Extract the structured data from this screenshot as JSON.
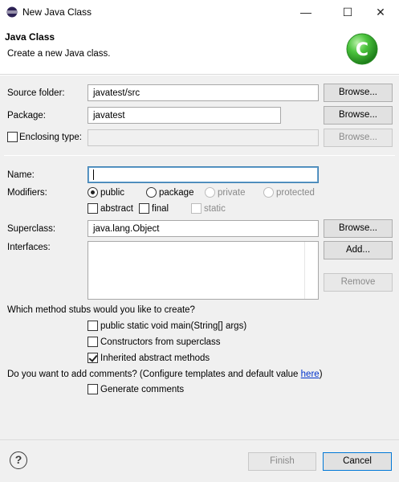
{
  "window": {
    "title": "New Java Class",
    "minimize": "—",
    "maximize": "☐",
    "close": "✕"
  },
  "header": {
    "title": "Java Class",
    "message": "Create a new Java class."
  },
  "form": {
    "source_folder": {
      "label": "Source folder:",
      "value": "javatest/src",
      "browse": "Browse..."
    },
    "package": {
      "label": "Package:",
      "value": "javatest",
      "browse": "Browse..."
    },
    "enclosing_type": {
      "label": "Enclosing type:",
      "value": "",
      "checked": false,
      "browse": "Browse..."
    },
    "name": {
      "label": "Name:",
      "value": ""
    },
    "modifiers": {
      "label": "Modifiers:",
      "public": "public",
      "package": "package",
      "private": "private",
      "protected": "protected",
      "abstract": "abstract",
      "final": "final",
      "static": "static"
    },
    "superclass": {
      "label": "Superclass:",
      "value": "java.lang.Object",
      "browse": "Browse..."
    },
    "interfaces": {
      "label": "Interfaces:",
      "add": "Add...",
      "remove": "Remove"
    },
    "stubs": {
      "question": "Which method stubs would you like to create?",
      "main": "public static void main(String[] args)",
      "constructors": "Constructors from superclass",
      "inherited": "Inherited abstract methods"
    },
    "comments": {
      "question": "Do you want to add comments? (Configure templates and default value ",
      "link": "here",
      "close_paren": ")",
      "generate": "Generate comments"
    }
  },
  "footer": {
    "help": "?",
    "finish": "Finish",
    "cancel": "Cancel"
  },
  "colors": {
    "accent": "#0078d7",
    "logo_green": "#3fb83a",
    "link": "#0033cc"
  }
}
